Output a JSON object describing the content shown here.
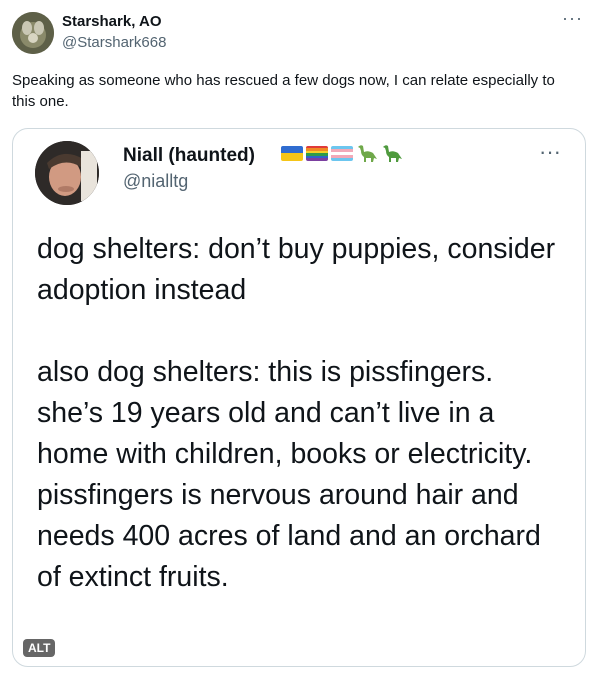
{
  "author": {
    "display_name": "Starshark, AO",
    "handle": "@Starshark668"
  },
  "tweet": {
    "text": "Speaking as someone who has rescued a few dogs now, I can relate especially to this one."
  },
  "more_options_icon": "more-horizontal-icon",
  "quoted": {
    "display_name": "Niall (haunted)",
    "handle": "@nialltg",
    "name_emojis": [
      "ukraine-flag-icon",
      "rainbow-flag-icon",
      "transgender-flag-icon",
      "sauropod-icon",
      "sauropod-icon"
    ],
    "paragraphs": [
      "dog shelters: don’t buy puppies, consider adoption instead",
      "also dog shelters: this is pissfingers. she’s 19 years old and can’t live in a home with children, books or electricity. pissfingers is nervous around hair and needs 400 acres of land and an orchard of extinct fruits."
    ],
    "alt_badge": "ALT"
  },
  "colors": {
    "text": "#0f1419",
    "secondary": "#536471",
    "border": "#cfd9de"
  }
}
